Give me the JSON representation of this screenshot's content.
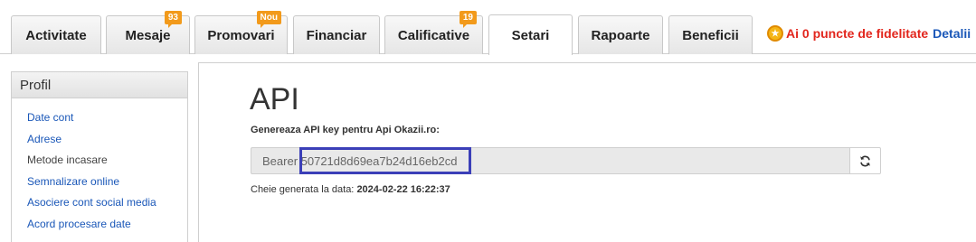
{
  "tabs": [
    {
      "label": "Activitate",
      "badge": ""
    },
    {
      "label": "Mesaje",
      "badge": "93"
    },
    {
      "label": "Promovari",
      "badge": "Nou"
    },
    {
      "label": "Financiar",
      "badge": ""
    },
    {
      "label": "Calificative",
      "badge": "19"
    },
    {
      "label": "Setari",
      "badge": "",
      "active": true
    },
    {
      "label": "Rapoarte",
      "badge": ""
    },
    {
      "label": "Beneficii",
      "badge": ""
    }
  ],
  "fidelity": {
    "text": "Ai 0 puncte de fidelitate",
    "link": "Detalii",
    "icon": "star-coin-icon",
    "text_color": "#e2261d",
    "link_color": "#1a57b8"
  },
  "sidebar": {
    "title": "Profil",
    "items": [
      {
        "label": "Date cont",
        "current": false
      },
      {
        "label": "Adrese",
        "current": false
      },
      {
        "label": "Metode incasare",
        "current": true
      },
      {
        "label": "Semnalizare online",
        "current": false
      },
      {
        "label": "Asociere cont social media",
        "current": false
      },
      {
        "label": "Acord procesare date",
        "current": false
      }
    ]
  },
  "main": {
    "title": "API",
    "gen_label": "Genereaza API key pentru Api Okazii.ro:",
    "api_key_value": "Bearer 50721d8d69ea7b24d16eb2cd",
    "refresh_icon": "refresh-icon",
    "gen_date_prefix": "Cheie generata la data:",
    "gen_date_value": "2024-02-22 16:22:37",
    "highlight_color": "#3b3fb8"
  },
  "colors": {
    "badge": "#f29a1b",
    "link": "#1a57b8",
    "border": "#cfcfcf"
  }
}
